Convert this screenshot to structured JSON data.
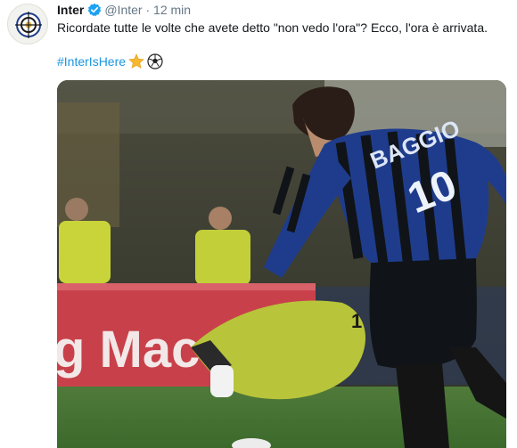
{
  "account": {
    "name": "Inter",
    "handle": "@Inter",
    "separator": "·",
    "time": "12 min"
  },
  "tweet": {
    "text": "Ricordate tutte le volte che avete detto \"non vedo l'ora\"? Ecco, l'ora è arrivata.",
    "hashtag": "#InterIsHere"
  },
  "media": {
    "ad_board_text": "g Mac",
    "shirt_name": "BAGGIO",
    "shirt_number": "10",
    "keeper_number": "1"
  },
  "colors": {
    "link": "#1b95e0",
    "verified": "#1da1f2",
    "meta": "#657786",
    "inter_blue": "#1f3c8c"
  },
  "icons": {
    "verified": "verified-badge-icon",
    "emoji_1": "star-emoji",
    "emoji_2": "soccer-ball-emoji"
  }
}
